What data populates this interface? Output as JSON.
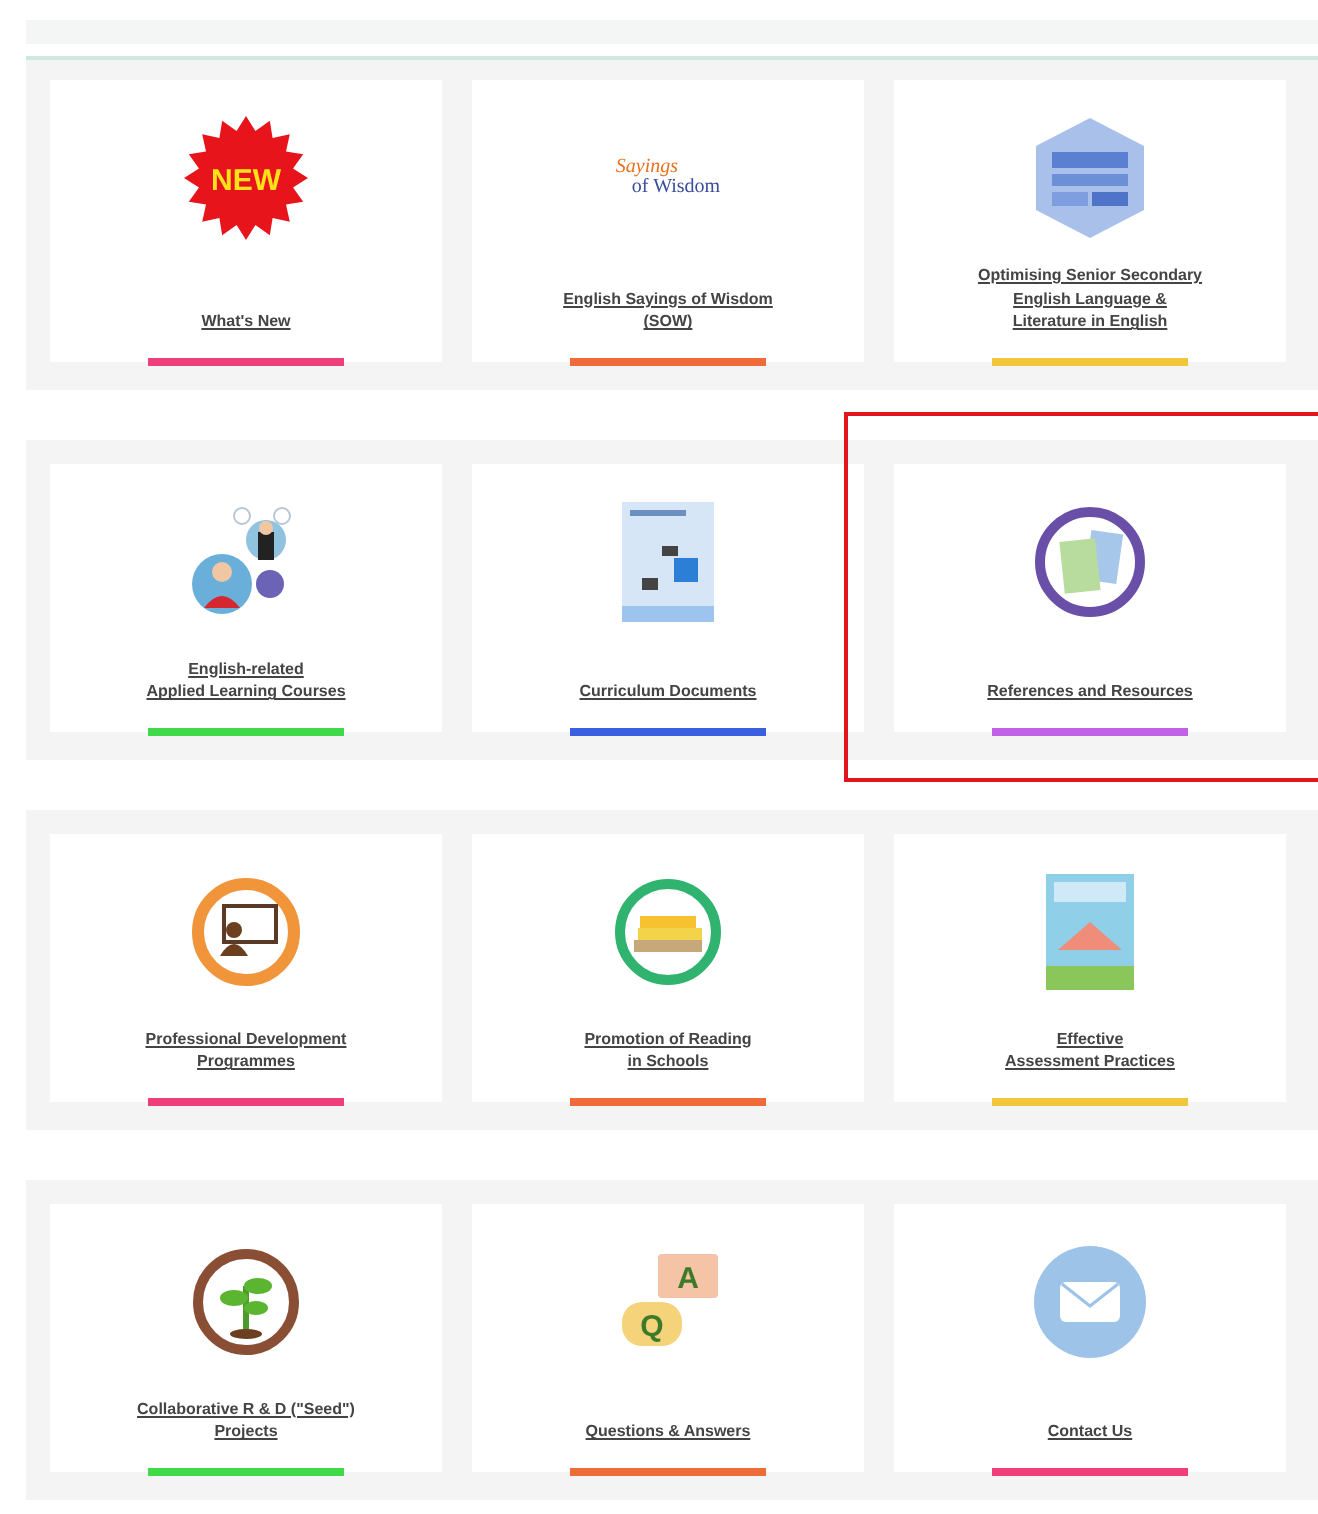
{
  "sections": [
    {
      "cards": [
        {
          "kind": "starburst",
          "icon_text": [
            "NEW"
          ],
          "title": "What's New",
          "color": "#ee3f7a",
          "highlighted": false
        },
        {
          "kind": "logo",
          "icon_text": [
            "Sayings",
            "of Wisdom"
          ],
          "title": "English Sayings of Wisdom\n(SOW)",
          "color": "#ef6c3a",
          "highlighted": false
        },
        {
          "kind": "cover",
          "title": "Optimising Senior Secondary\nEnglish Language &\nLiterature in English",
          "color": "#f2c63a",
          "highlighted": false
        }
      ]
    },
    {
      "cards": [
        {
          "kind": "people",
          "title": "English-related\nApplied Learning Courses",
          "color": "#3fd94a",
          "highlighted": false
        },
        {
          "kind": "document",
          "title": "Curriculum Documents",
          "color": "#3a5fe0",
          "highlighted": false
        },
        {
          "kind": "papers",
          "title": "References and Resources",
          "color": "#c061e8",
          "highlighted": true
        }
      ]
    },
    {
      "cards": [
        {
          "kind": "teacher",
          "title": "Professional Development\nProgrammes",
          "color": "#ee3f7a",
          "highlighted": false
        },
        {
          "kind": "books",
          "title": "Promotion of Reading\nin Schools",
          "color": "#ef6c3a",
          "highlighted": false
        },
        {
          "kind": "poster",
          "title": "Effective\nAssessment Practices",
          "color": "#f2c63a",
          "highlighted": false
        }
      ]
    },
    {
      "cards": [
        {
          "kind": "seedling",
          "title": "Collaborative R & D (\"Seed\")\nProjects",
          "color": "#3fd94a",
          "highlighted": false
        },
        {
          "kind": "qa",
          "icon_text": [
            "A",
            "Q"
          ],
          "title": "Questions & Answers",
          "color": "#ef6c3a",
          "highlighted": false
        },
        {
          "kind": "envelope",
          "title": "Contact Us",
          "color": "#ee3f7a",
          "highlighted": false
        }
      ]
    }
  ]
}
